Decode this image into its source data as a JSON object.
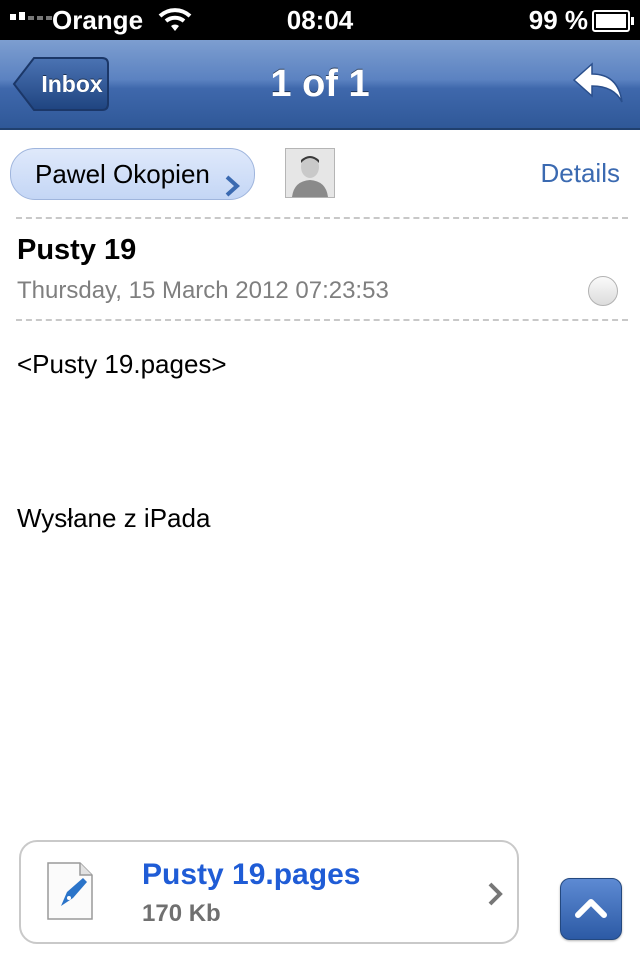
{
  "status_bar": {
    "carrier": "Orange",
    "time": "08:04",
    "battery": "99 %",
    "battery_level": 0.99
  },
  "nav": {
    "back_label": "Inbox",
    "title": "1 of 1",
    "reply_icon": "reply-arrow-icon"
  },
  "message": {
    "sender": "Pawel Okopien",
    "details_label": "Details",
    "subject": "Pusty 19",
    "date": "Thursday, 15 March 2012 07:23:53",
    "body_lines": [
      "<Pusty 19.pages>",
      "Wysłane z iPada"
    ]
  },
  "attachment": {
    "name": "Pusty 19.pages",
    "size": "170 Kb",
    "icon": "pages-document-icon"
  },
  "colors": {
    "accent": "#3b6ab1",
    "link": "#1f5cd6",
    "nav_dark": "#2f5898"
  }
}
